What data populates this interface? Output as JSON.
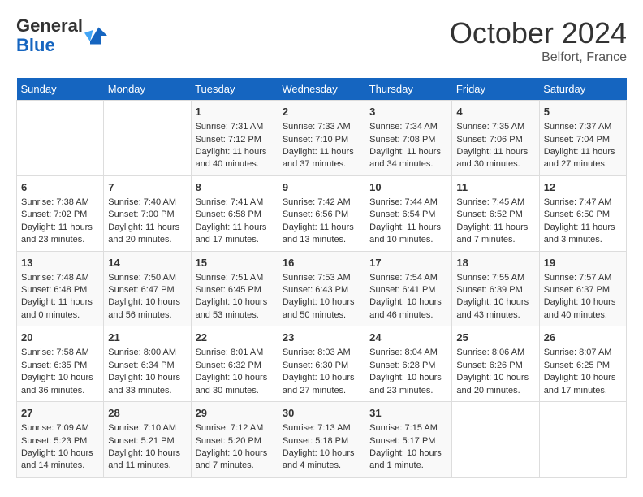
{
  "header": {
    "logo_general": "General",
    "logo_blue": "Blue",
    "month_title": "October 2024",
    "location": "Belfort, France"
  },
  "weekdays": [
    "Sunday",
    "Monday",
    "Tuesday",
    "Wednesday",
    "Thursday",
    "Friday",
    "Saturday"
  ],
  "weeks": [
    [
      {
        "day": "",
        "sunrise": "",
        "sunset": "",
        "daylight": ""
      },
      {
        "day": "",
        "sunrise": "",
        "sunset": "",
        "daylight": ""
      },
      {
        "day": "1",
        "sunrise": "Sunrise: 7:31 AM",
        "sunset": "Sunset: 7:12 PM",
        "daylight": "Daylight: 11 hours and 40 minutes."
      },
      {
        "day": "2",
        "sunrise": "Sunrise: 7:33 AM",
        "sunset": "Sunset: 7:10 PM",
        "daylight": "Daylight: 11 hours and 37 minutes."
      },
      {
        "day": "3",
        "sunrise": "Sunrise: 7:34 AM",
        "sunset": "Sunset: 7:08 PM",
        "daylight": "Daylight: 11 hours and 34 minutes."
      },
      {
        "day": "4",
        "sunrise": "Sunrise: 7:35 AM",
        "sunset": "Sunset: 7:06 PM",
        "daylight": "Daylight: 11 hours and 30 minutes."
      },
      {
        "day": "5",
        "sunrise": "Sunrise: 7:37 AM",
        "sunset": "Sunset: 7:04 PM",
        "daylight": "Daylight: 11 hours and 27 minutes."
      }
    ],
    [
      {
        "day": "6",
        "sunrise": "Sunrise: 7:38 AM",
        "sunset": "Sunset: 7:02 PM",
        "daylight": "Daylight: 11 hours and 23 minutes."
      },
      {
        "day": "7",
        "sunrise": "Sunrise: 7:40 AM",
        "sunset": "Sunset: 7:00 PM",
        "daylight": "Daylight: 11 hours and 20 minutes."
      },
      {
        "day": "8",
        "sunrise": "Sunrise: 7:41 AM",
        "sunset": "Sunset: 6:58 PM",
        "daylight": "Daylight: 11 hours and 17 minutes."
      },
      {
        "day": "9",
        "sunrise": "Sunrise: 7:42 AM",
        "sunset": "Sunset: 6:56 PM",
        "daylight": "Daylight: 11 hours and 13 minutes."
      },
      {
        "day": "10",
        "sunrise": "Sunrise: 7:44 AM",
        "sunset": "Sunset: 6:54 PM",
        "daylight": "Daylight: 11 hours and 10 minutes."
      },
      {
        "day": "11",
        "sunrise": "Sunrise: 7:45 AM",
        "sunset": "Sunset: 6:52 PM",
        "daylight": "Daylight: 11 hours and 7 minutes."
      },
      {
        "day": "12",
        "sunrise": "Sunrise: 7:47 AM",
        "sunset": "Sunset: 6:50 PM",
        "daylight": "Daylight: 11 hours and 3 minutes."
      }
    ],
    [
      {
        "day": "13",
        "sunrise": "Sunrise: 7:48 AM",
        "sunset": "Sunset: 6:48 PM",
        "daylight": "Daylight: 11 hours and 0 minutes."
      },
      {
        "day": "14",
        "sunrise": "Sunrise: 7:50 AM",
        "sunset": "Sunset: 6:47 PM",
        "daylight": "Daylight: 10 hours and 56 minutes."
      },
      {
        "day": "15",
        "sunrise": "Sunrise: 7:51 AM",
        "sunset": "Sunset: 6:45 PM",
        "daylight": "Daylight: 10 hours and 53 minutes."
      },
      {
        "day": "16",
        "sunrise": "Sunrise: 7:53 AM",
        "sunset": "Sunset: 6:43 PM",
        "daylight": "Daylight: 10 hours and 50 minutes."
      },
      {
        "day": "17",
        "sunrise": "Sunrise: 7:54 AM",
        "sunset": "Sunset: 6:41 PM",
        "daylight": "Daylight: 10 hours and 46 minutes."
      },
      {
        "day": "18",
        "sunrise": "Sunrise: 7:55 AM",
        "sunset": "Sunset: 6:39 PM",
        "daylight": "Daylight: 10 hours and 43 minutes."
      },
      {
        "day": "19",
        "sunrise": "Sunrise: 7:57 AM",
        "sunset": "Sunset: 6:37 PM",
        "daylight": "Daylight: 10 hours and 40 minutes."
      }
    ],
    [
      {
        "day": "20",
        "sunrise": "Sunrise: 7:58 AM",
        "sunset": "Sunset: 6:35 PM",
        "daylight": "Daylight: 10 hours and 36 minutes."
      },
      {
        "day": "21",
        "sunrise": "Sunrise: 8:00 AM",
        "sunset": "Sunset: 6:34 PM",
        "daylight": "Daylight: 10 hours and 33 minutes."
      },
      {
        "day": "22",
        "sunrise": "Sunrise: 8:01 AM",
        "sunset": "Sunset: 6:32 PM",
        "daylight": "Daylight: 10 hours and 30 minutes."
      },
      {
        "day": "23",
        "sunrise": "Sunrise: 8:03 AM",
        "sunset": "Sunset: 6:30 PM",
        "daylight": "Daylight: 10 hours and 27 minutes."
      },
      {
        "day": "24",
        "sunrise": "Sunrise: 8:04 AM",
        "sunset": "Sunset: 6:28 PM",
        "daylight": "Daylight: 10 hours and 23 minutes."
      },
      {
        "day": "25",
        "sunrise": "Sunrise: 8:06 AM",
        "sunset": "Sunset: 6:26 PM",
        "daylight": "Daylight: 10 hours and 20 minutes."
      },
      {
        "day": "26",
        "sunrise": "Sunrise: 8:07 AM",
        "sunset": "Sunset: 6:25 PM",
        "daylight": "Daylight: 10 hours and 17 minutes."
      }
    ],
    [
      {
        "day": "27",
        "sunrise": "Sunrise: 7:09 AM",
        "sunset": "Sunset: 5:23 PM",
        "daylight": "Daylight: 10 hours and 14 minutes."
      },
      {
        "day": "28",
        "sunrise": "Sunrise: 7:10 AM",
        "sunset": "Sunset: 5:21 PM",
        "daylight": "Daylight: 10 hours and 11 minutes."
      },
      {
        "day": "29",
        "sunrise": "Sunrise: 7:12 AM",
        "sunset": "Sunset: 5:20 PM",
        "daylight": "Daylight: 10 hours and 7 minutes."
      },
      {
        "day": "30",
        "sunrise": "Sunrise: 7:13 AM",
        "sunset": "Sunset: 5:18 PM",
        "daylight": "Daylight: 10 hours and 4 minutes."
      },
      {
        "day": "31",
        "sunrise": "Sunrise: 7:15 AM",
        "sunset": "Sunset: 5:17 PM",
        "daylight": "Daylight: 10 hours and 1 minute."
      },
      {
        "day": "",
        "sunrise": "",
        "sunset": "",
        "daylight": ""
      },
      {
        "day": "",
        "sunrise": "",
        "sunset": "",
        "daylight": ""
      }
    ]
  ]
}
